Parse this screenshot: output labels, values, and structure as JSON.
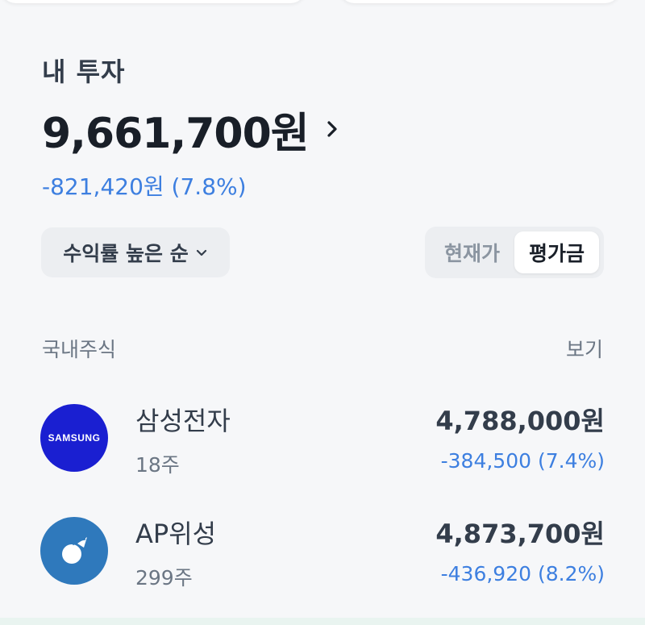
{
  "section_title": "내 투자",
  "total": {
    "amount": "9,661,700원",
    "change": "-821,420원 (7.8%)"
  },
  "sort": {
    "label": "수익률 높은 순"
  },
  "toggle": {
    "options": [
      "현재가",
      "평가금"
    ],
    "selected": "평가금"
  },
  "category": {
    "label": "국내주식",
    "view_label": "보기"
  },
  "stocks": [
    {
      "name": "삼성전자",
      "quantity": "18주",
      "value": "4,788,000원",
      "change": "-384,500 (7.4%)",
      "logo_text": "SAMSUNG"
    },
    {
      "name": "AP위성",
      "quantity": "299주",
      "value": "4,873,700원",
      "change": "-436,920 (8.2%)"
    }
  ],
  "colors": {
    "negative_change": "#3d7fe0",
    "samsung_brand": "#1a1fd1",
    "ap_brand": "#2f79bc"
  },
  "icons": [
    "chevron-right-icon",
    "chevron-down-icon",
    "samsung-logo-icon",
    "ap-satellite-logo-icon"
  ]
}
